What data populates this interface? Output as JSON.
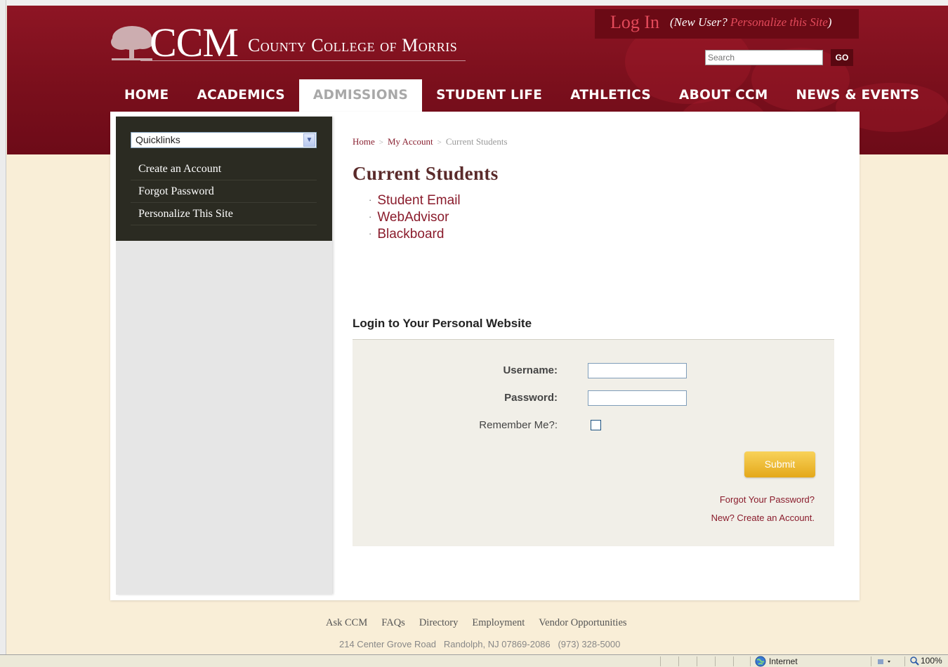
{
  "header": {
    "logo_acronym": "CCM",
    "logo_name": "County College of Morris",
    "login_label": "Log In",
    "new_user_prefix": "(New User? ",
    "personalize_label": "Personalize this Site",
    "new_user_suffix": ")",
    "search_placeholder": "Search",
    "search_button": "GO"
  },
  "nav": {
    "items": [
      {
        "label": "HOME"
      },
      {
        "label": "ACADEMICS"
      },
      {
        "label": "ADMISSIONS",
        "active": true
      },
      {
        "label": "STUDENT LIFE"
      },
      {
        "label": "ATHLETICS"
      },
      {
        "label": "ABOUT CCM"
      },
      {
        "label": "NEWS & EVENTS"
      }
    ]
  },
  "sidebar": {
    "quicklinks_selected": "Quicklinks",
    "links": [
      {
        "label": "Create an Account"
      },
      {
        "label": "Forgot Password"
      },
      {
        "label": "Personalize This Site"
      }
    ]
  },
  "breadcrumb": {
    "items": [
      "Home",
      "My Account",
      "Current Students"
    ],
    "separator": ">"
  },
  "main": {
    "title": "Current Students",
    "links": [
      "Student Email",
      "WebAdvisor",
      "Blackboard"
    ],
    "bullet": "·"
  },
  "login_form": {
    "heading": "Login to Your Personal Website",
    "username_label": "Username:",
    "username_value": "",
    "password_label": "Password:",
    "password_value": "",
    "remember_label": "Remember Me?:",
    "remember_checked": false,
    "submit_label": "Submit",
    "forgot_link": "Forgot Your Password?",
    "create_link": "New? Create an Account."
  },
  "footer": {
    "links": [
      "Ask CCM",
      "FAQs",
      "Directory",
      "Employment",
      "Vendor Opportunities"
    ],
    "address": "214 Center Grove Road   Randolph, NJ 07869-2086   (973) 328-5000"
  },
  "statusbar": {
    "zone": "Internet",
    "zoom": "100%"
  },
  "colors": {
    "brand_maroon": "#7a0f1c",
    "link_red": "#8a1c2c",
    "submit_gold": "#e4a81a",
    "sidebar_dark": "#2b2b22",
    "page_cream": "#f9eed7"
  }
}
